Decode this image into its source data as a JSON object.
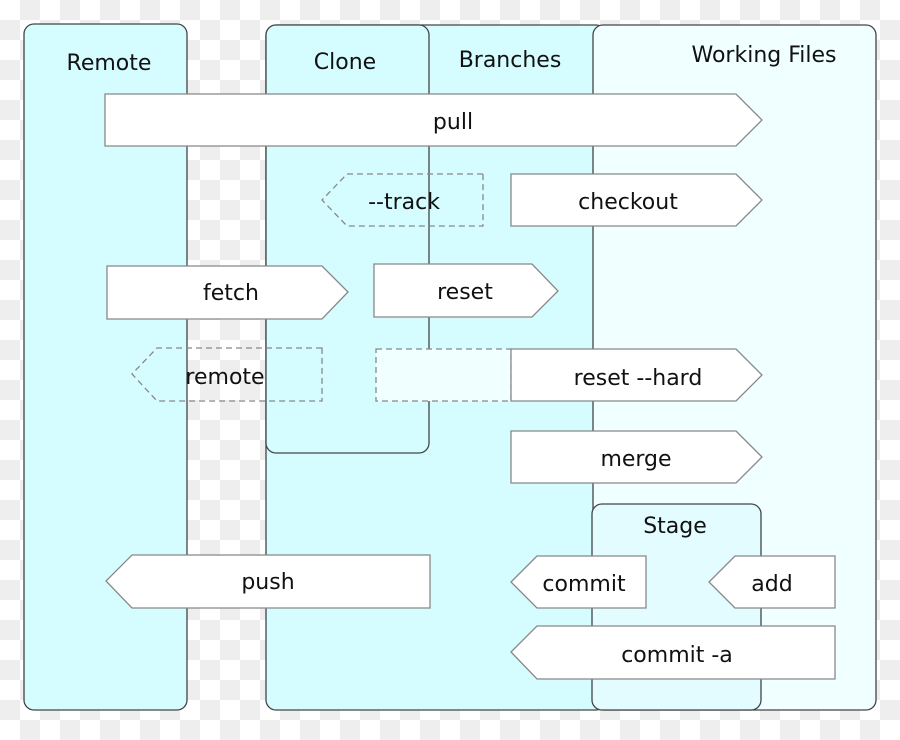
{
  "lanes": {
    "remote": "Remote",
    "clone": "Clone",
    "branches": "Branches",
    "working_files": "Working Files",
    "stage": "Stage"
  },
  "commands": {
    "pull": "pull",
    "track": "--track",
    "checkout": "checkout",
    "fetch": "fetch",
    "reset": "reset",
    "remote": "remote",
    "reset_hard": "reset --hard",
    "merge": "merge",
    "push": "push",
    "commit": "commit",
    "add": "add",
    "commit_a": "commit -a"
  },
  "colors": {
    "lane_cyan": "#d5fdff",
    "lane_light": "#f0ffff",
    "stage_fill": "#e2fcff",
    "stroke": "#444444",
    "arrow_fill": "#ffffff",
    "arrow_stroke": "#888888"
  }
}
